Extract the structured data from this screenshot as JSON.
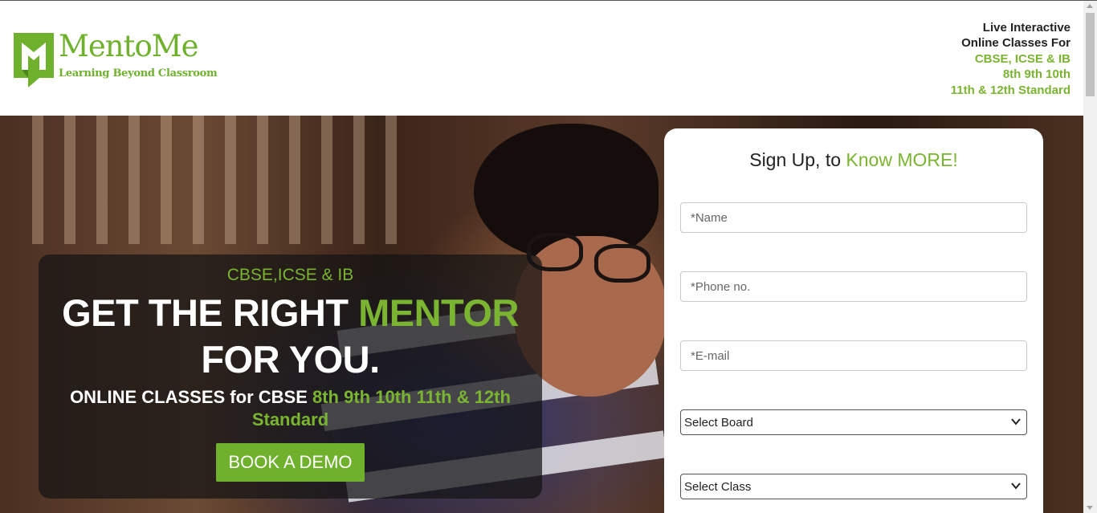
{
  "brand": {
    "name": "MentoMe",
    "tagline": "Learning Beyond Classroom",
    "color": "#6fb12c"
  },
  "header_info": {
    "line1": "Live Interactive",
    "line2": "Online Classes For",
    "line3": "CBSE, ICSE & IB",
    "line4": "8th 9th 10th",
    "line5": "11th & 12th Standard"
  },
  "hero": {
    "subheading": "CBSE,ICSE & IB",
    "title_part1": "GET THE RIGHT ",
    "title_highlight": "MENTOR",
    "title_part2": "FOR YOU.",
    "classes_prefix": "ONLINE CLASSES for CBSE ",
    "classes_highlight": "8th 9th 10th 11th & 12th Standard",
    "cta_label": "BOOK A DEMO"
  },
  "signup": {
    "title_prefix": "Sign Up, to ",
    "title_highlight": "Know MORE!",
    "name_placeholder": "*Name",
    "phone_placeholder": "*Phone no.",
    "email_placeholder": "*E-mail",
    "board_selected": "Select Board",
    "class_selected": "Select Class"
  },
  "icons": {
    "logo": "mentome-logo-icon",
    "select_chevron": "chevron-down-icon"
  }
}
